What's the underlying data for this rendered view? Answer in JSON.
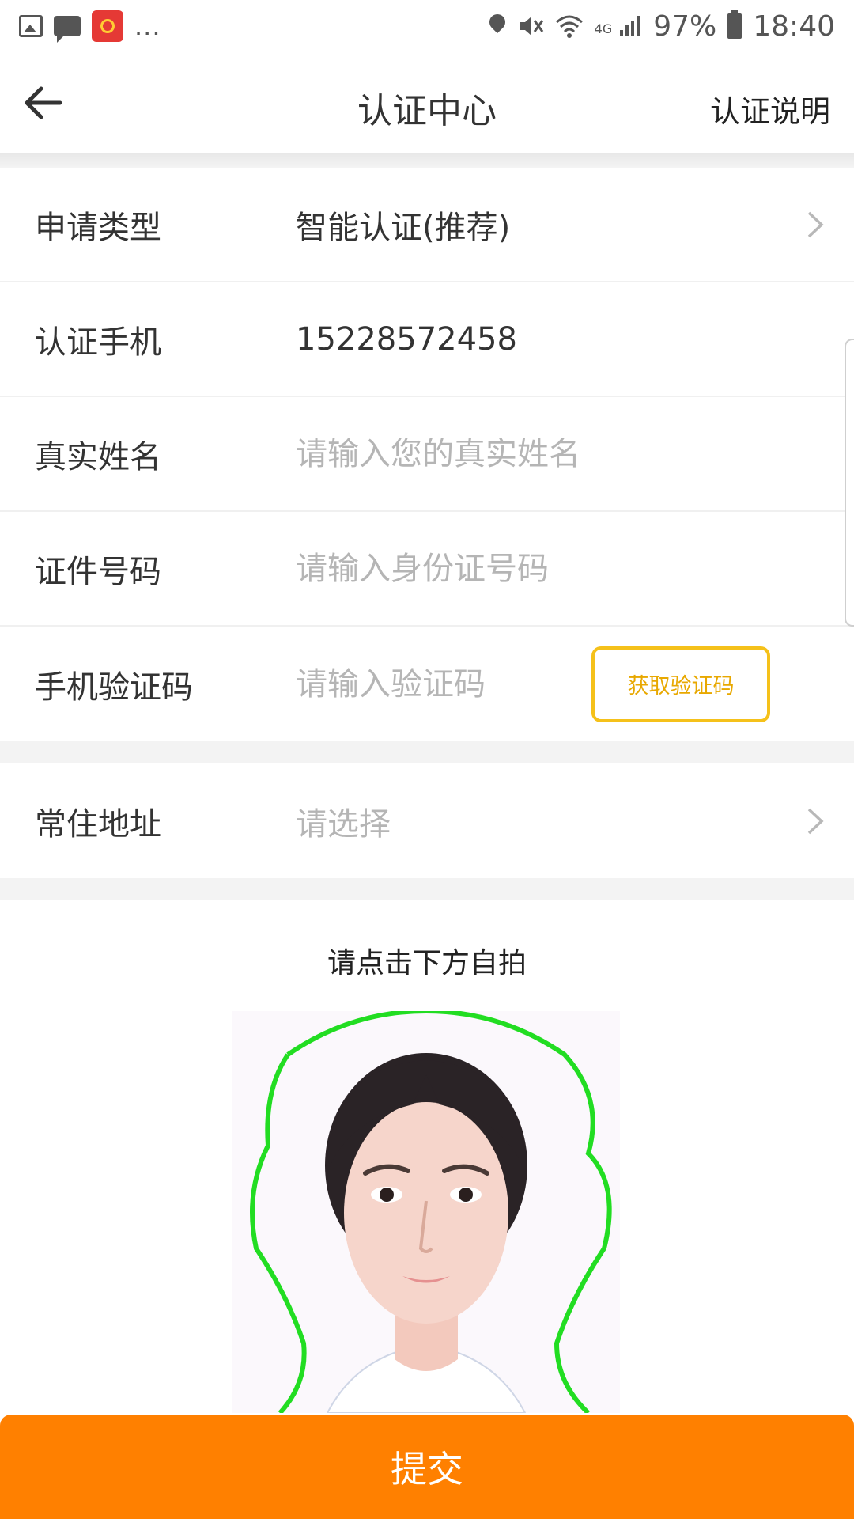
{
  "status_bar": {
    "ellipsis": "...",
    "network": "4G",
    "battery": "97%",
    "time": "18:40",
    "icons": [
      "gallery-icon",
      "chat-icon",
      "app-badge-icon",
      "location-icon",
      "mute-icon",
      "wifi-icon",
      "signal-icon",
      "battery-icon"
    ]
  },
  "header": {
    "title": "认证中心",
    "help_link": "认证说明",
    "back_icon": "arrow-left-icon"
  },
  "form": {
    "rows": [
      {
        "label": "申请类型",
        "value": "智能认证(推荐)"
      },
      {
        "label": "认证手机",
        "value": "15228572458"
      },
      {
        "label": "真实姓名",
        "placeholder": "请输入您的真实姓名"
      },
      {
        "label": "证件号码",
        "placeholder": "请输入身份证号码"
      },
      {
        "label": "手机验证码",
        "placeholder": "请输入验证码",
        "button": "获取验证码"
      },
      {
        "label": "常住地址",
        "placeholder": "请选择"
      }
    ]
  },
  "selfie": {
    "instruction": "请点击下方自拍"
  },
  "submit": {
    "label": "提交"
  },
  "colors": {
    "accent": "#ff8000",
    "code_button": "#f5c11a",
    "face_outline": "#22dd22",
    "placeholder": "#b5b5b5"
  }
}
